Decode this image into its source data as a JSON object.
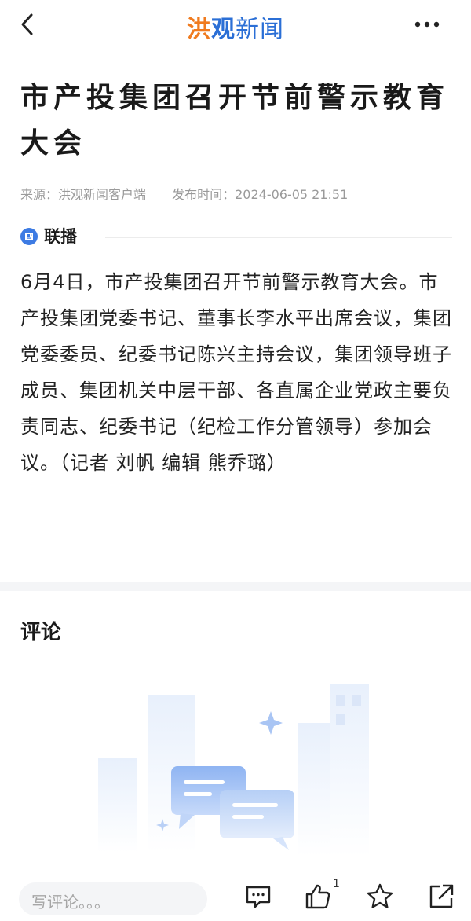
{
  "app": {
    "logo_part1": "洪",
    "logo_part2": "观",
    "logo_part3": "新闻"
  },
  "article": {
    "title": "市产投集团召开节前警示教育大会",
    "source": "来源：洪观新闻客户端",
    "publish_time": "发布时间：2024-06-05 21:51",
    "tag": "联播",
    "body": "6月4日，市产投集团召开节前警示教育大会。市产投集团党委书记、董事长李水平出席会议，集团党委委员、纪委书记陈兴主持会议，集团领导班子成员、集团机关中层干部、各直属企业党政主要负责同志、纪委书记（纪检工作分管领导）参加会议。（记者 刘帆 编辑 熊乔璐）"
  },
  "comments": {
    "title": "评论",
    "input_placeholder": "写评论。。。",
    "like_count": "1"
  },
  "icons": {
    "back": "chevron-left-icon",
    "more": "more-dots-icon",
    "tag": "news-icon",
    "comment": "comment-bubble-icon",
    "like": "thumb-up-icon",
    "favorite": "star-icon",
    "share": "share-icon"
  },
  "colors": {
    "brand_orange": "#f07b1f",
    "brand_blue": "#2b6fd6"
  }
}
